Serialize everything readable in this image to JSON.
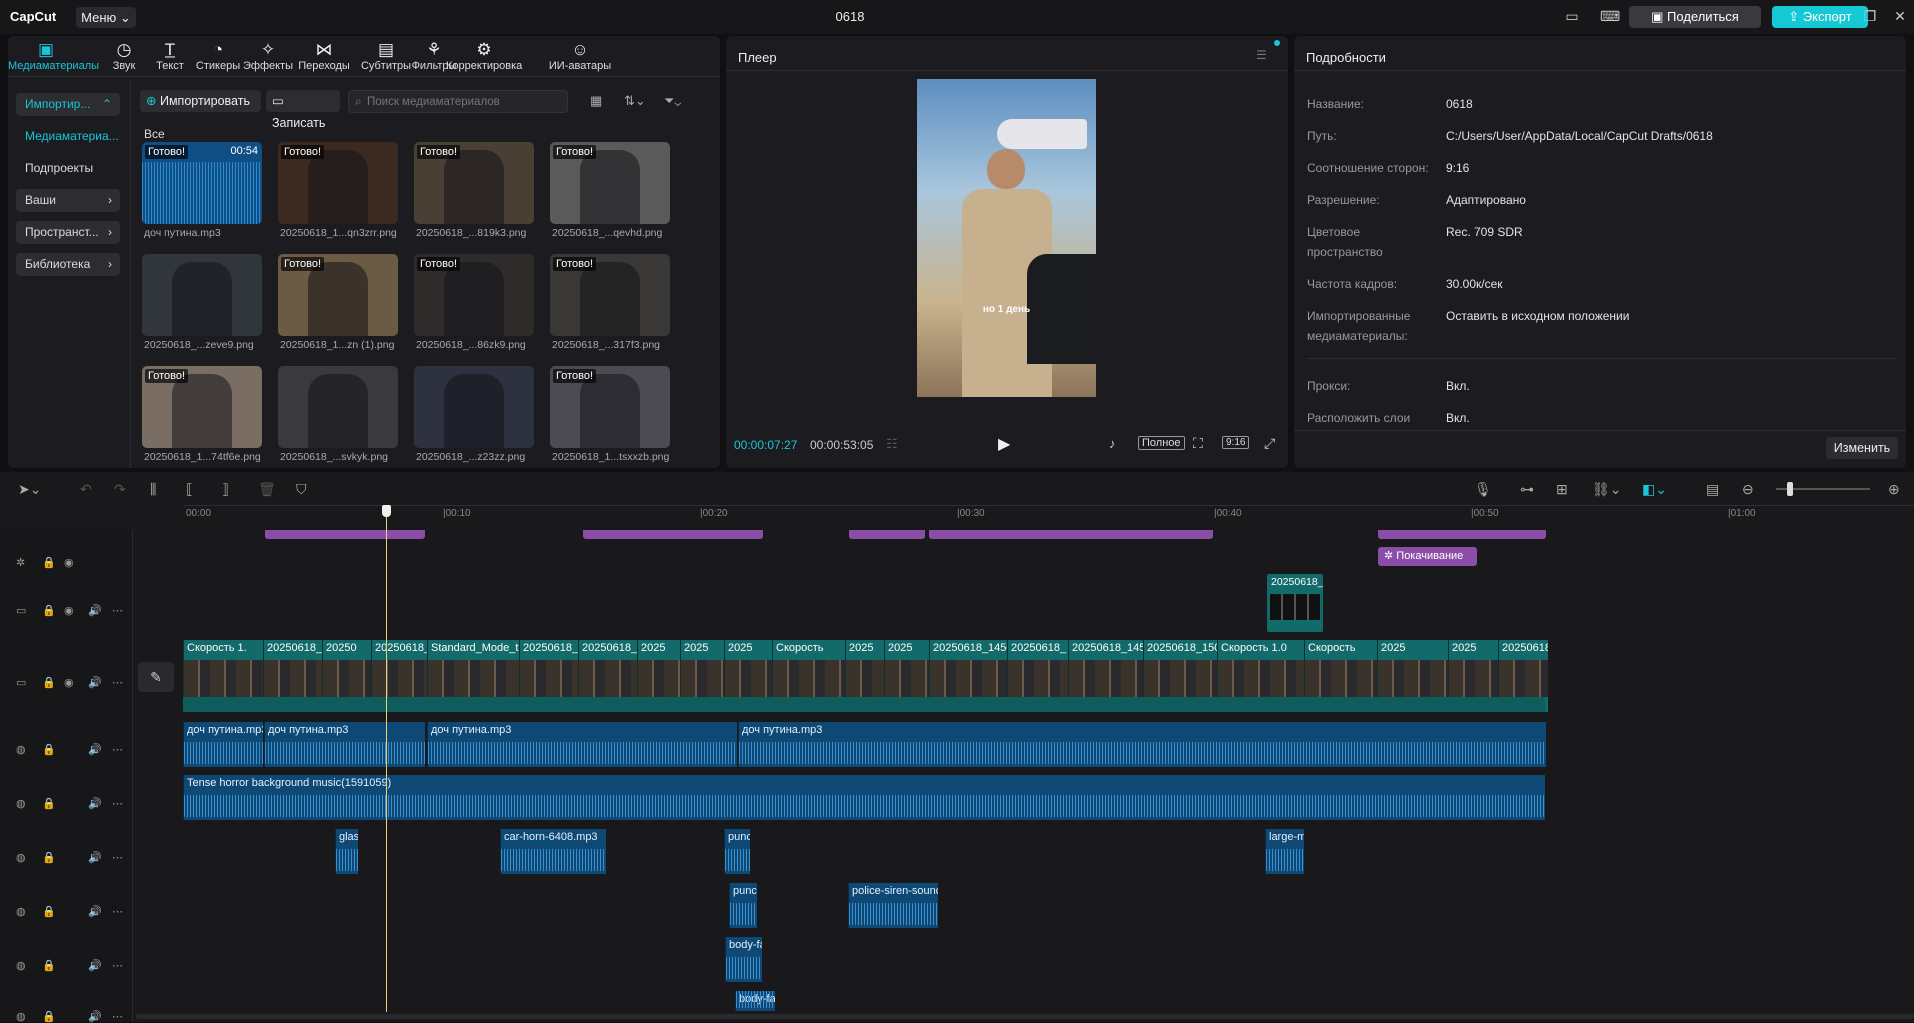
{
  "app": {
    "logo": "CapCut",
    "menu": "Меню",
    "title": "0618",
    "share": "Поделиться",
    "export": "Экспорт"
  },
  "tabs": [
    {
      "icon": "media-icon",
      "label": "Медиаматериалы"
    },
    {
      "icon": "audio-icon",
      "label": "Звук"
    },
    {
      "icon": "text-icon",
      "label": "Текст"
    },
    {
      "icon": "sticker-icon",
      "label": "Стикеры"
    },
    {
      "icon": "effects-icon",
      "label": "Эффекты"
    },
    {
      "icon": "transitions-icon",
      "label": "Переходы"
    },
    {
      "icon": "subtitles-icon",
      "label": "Субтитры"
    },
    {
      "icon": "filters-icon",
      "label": "Фильтры"
    },
    {
      "icon": "adjust-icon",
      "label": "Корректировка"
    },
    {
      "icon": "ai-avatar-icon",
      "label": "ИИ-аватары"
    }
  ],
  "sidebar": {
    "import": "Импортир...",
    "media": "Медиаматериа...",
    "subprojects": "Подпроекты",
    "yours": "Ваши",
    "spaces": "Пространст...",
    "library": "Библиотека"
  },
  "media_toolbar": {
    "import": "Импортировать",
    "record": "Записать",
    "search_placeholder": "Поиск медиаматериалов",
    "all": "Все"
  },
  "media": [
    {
      "name": "доч путина.mp3",
      "ready": "Готово!",
      "duration": "00:54"
    },
    {
      "name": "20250618_1...qn3zrr.png",
      "ready": "Готово!"
    },
    {
      "name": "20250618_...819k3.png",
      "ready": "Готово!"
    },
    {
      "name": "20250618_...qevhd.png",
      "ready": "Готово!"
    },
    {
      "name": "20250618_...zeve9.png",
      "ready": ""
    },
    {
      "name": "20250618_1...zn (1).png",
      "ready": "Готово!"
    },
    {
      "name": "20250618_...86zk9.png",
      "ready": "Готово!"
    },
    {
      "name": "20250618_...317f3.png",
      "ready": "Готово!"
    },
    {
      "name": "20250618_1...74tf6e.png",
      "ready": "Готово!"
    },
    {
      "name": "20250618_...svkyk.png",
      "ready": ""
    },
    {
      "name": "20250618_...z23zz.png",
      "ready": ""
    },
    {
      "name": "20250618_1...tsxxzb.png",
      "ready": "Готово!"
    }
  ],
  "player": {
    "title": "Плеер",
    "current": "00:00:07:27",
    "total": "00:00:53:05",
    "full": "Полное",
    "ratio": "9:16",
    "subtitle": "но 1 день"
  },
  "details": {
    "title": "Подробности",
    "edit": "Изменить",
    "rows": [
      {
        "label": "Название:",
        "value": "0618"
      },
      {
        "label": "Путь:",
        "value": "C:/Users/User/AppData/Local/CapCut Drafts/0618"
      },
      {
        "label": "Соотношение сторон:",
        "value": "9:16"
      },
      {
        "label": "Разрешение:",
        "value": "Адаптировано"
      },
      {
        "label": "Цветовое пространство",
        "value": "Rec. 709 SDR"
      },
      {
        "label": "Частота кадров:",
        "value": "30.00к/сек"
      },
      {
        "label": "Импортированные медиаматериалы:",
        "value": "Оставить в исходном положении"
      },
      {
        "label": "Прокси:",
        "value": "Вкл."
      },
      {
        "label": "Расположить слои",
        "value": "Вкл."
      }
    ]
  },
  "ruler": [
    "00:00",
    "|00:10",
    "|00:20",
    "|00:30",
    "|00:40",
    "|00:50",
    "|01:00"
  ],
  "timeline": {
    "fx_label": "Покачивание",
    "overlay_clip": "20250618_",
    "video_clips": [
      "Скорость 1.",
      "20250618_",
      "20250",
      "20250618_",
      "Standard_Mode_th",
      "20250618_",
      "20250618_",
      "2025",
      "2025",
      "2025",
      "Скорость",
      "2025",
      "2025",
      "20250618_1450",
      "20250618_",
      "20250618_145",
      "20250618_150",
      "Скорость 1.0",
      "Скорость",
      "2025",
      "2025",
      "20250618_1"
    ],
    "voice_clips": [
      "доч путина.mp3",
      "доч путина.mp3",
      "доч путина.mp3",
      "доч путина.mp3"
    ],
    "music": "Tense horror background music(1591059)",
    "sfx": [
      "glass",
      "car-horn-6408.mp3",
      "punc",
      "large-m",
      "punc",
      "police-siren-sound",
      "body-fa",
      "body-fa"
    ]
  },
  "colors": {
    "accent": "#18c6d6",
    "video": "#136a6a",
    "audio": "#0e4874",
    "effect": "#8b4ea8"
  }
}
